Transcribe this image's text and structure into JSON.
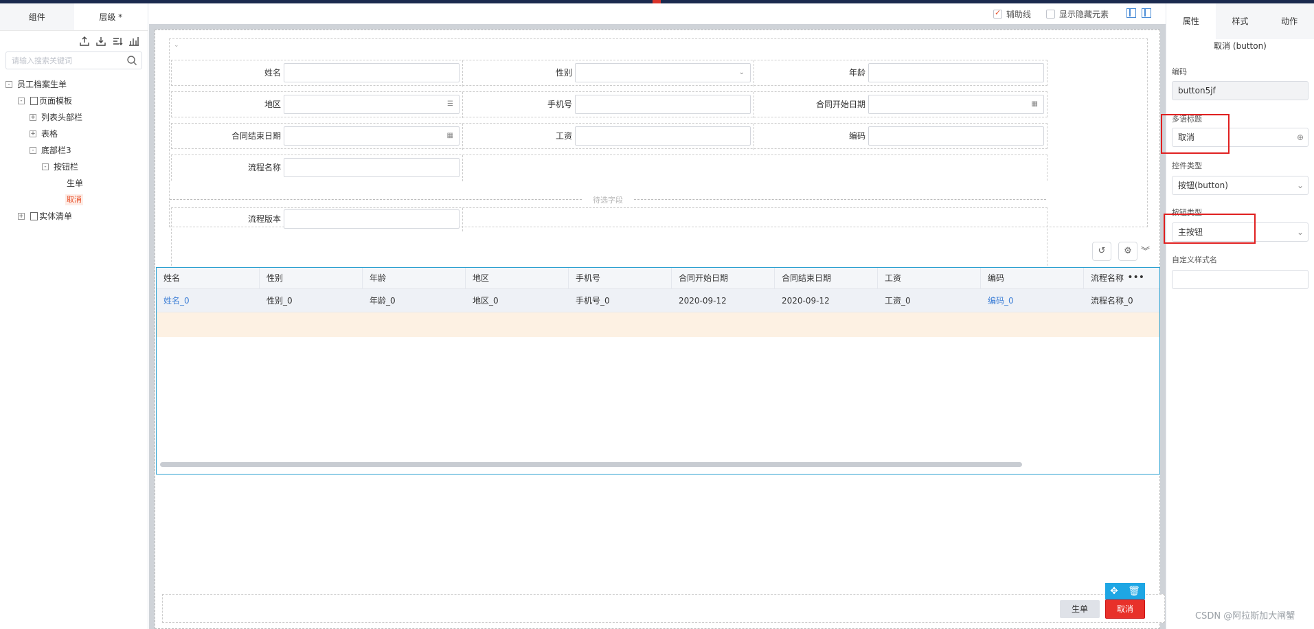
{
  "left_panel": {
    "tabs": [
      "组件",
      "层级 *"
    ],
    "search_placeholder": "请输入搜索关键词",
    "tree": [
      {
        "label": "员工档案生单",
        "toggle": "-"
      },
      {
        "label": "页面模板",
        "toggle": "-"
      },
      {
        "label": "列表头部栏",
        "toggle": "+"
      },
      {
        "label": "表格",
        "toggle": "+"
      },
      {
        "label": "底部栏3",
        "toggle": "-"
      },
      {
        "label": "按钮栏",
        "toggle": "-"
      },
      {
        "label": "生单",
        "toggle": ""
      },
      {
        "label": "取消",
        "toggle": ""
      },
      {
        "label": "实体清单",
        "toggle": "+"
      }
    ]
  },
  "topbar": {
    "helper_lines_label": "辅助线",
    "show_hidden_label": "显示隐藏元素"
  },
  "form": {
    "fields": {
      "name": "姓名",
      "gender": "性别",
      "age": "年龄",
      "region": "地区",
      "phone": "手机号",
      "contract_start": "合同开始日期",
      "contract_end": "合同结束日期",
      "salary": "工资",
      "code": "编码",
      "flow_name": "流程名称",
      "flow_version": "流程版本"
    },
    "pending_label": "待选字段"
  },
  "grid": {
    "columns": [
      "姓名",
      "性别",
      "年龄",
      "地区",
      "手机号",
      "合同开始日期",
      "合同结束日期",
      "工资",
      "编码",
      "流程名称"
    ],
    "rows": [
      [
        "姓名_0",
        "性别_0",
        "年龄_0",
        "地区_0",
        "手机号_0",
        "2020-09-12",
        "2020-09-12",
        "工资_0",
        "编码_0",
        "流程名称_0"
      ]
    ],
    "more_icon": "ellipsis-icon"
  },
  "bottom": {
    "generate_label": "生单",
    "cancel_label": "取消"
  },
  "right_panel": {
    "tabs": [
      "属性",
      "样式",
      "动作"
    ],
    "selected_title": "取消 (button)",
    "code_label": "编码",
    "code_value": "button5jf",
    "multilang_label": "多语标题",
    "multilang_value": "取消",
    "control_type_label": "控件类型",
    "control_type_value": "按钮(button)",
    "button_type_label": "按钮类型",
    "button_type_value": "主按钮",
    "custom_style_label": "自定义样式名",
    "custom_style_value": ""
  },
  "watermark": "CSDN @阿拉斯加大闸蟹"
}
